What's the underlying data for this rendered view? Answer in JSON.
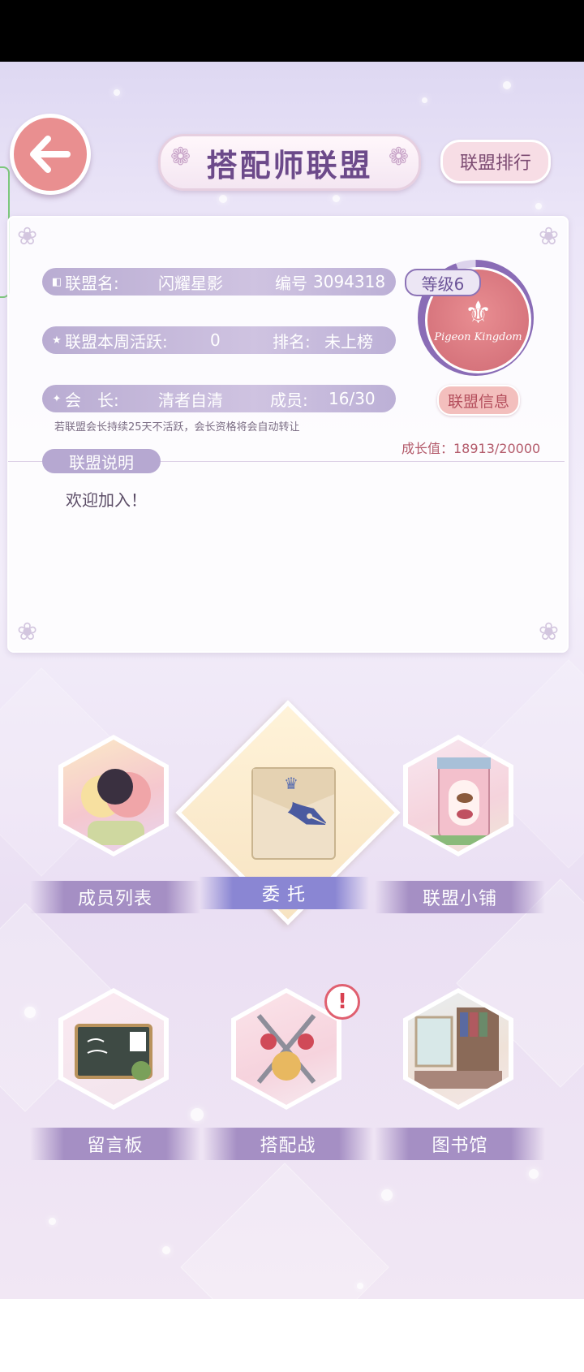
{
  "header": {
    "title": "搭配师联盟",
    "rank_button": "联盟排行"
  },
  "alliance": {
    "name_label": "联盟名:",
    "name_value": "闪耀星影",
    "id_label": "编号",
    "id_value": "3094318",
    "weekly_label": "联盟本周活跃:",
    "weekly_value": "0",
    "rank_label": "排名:",
    "rank_value": "未上榜",
    "leader_label": "会　长:",
    "leader_value": "清者自清",
    "members_label": "成员:",
    "members_value": "16/30",
    "level": "等级6",
    "emblem_text": "Pigeon Kingdom",
    "info_button": "联盟信息",
    "warning": "若联盟会长持续25天不活跃，会长资格将会自动转让",
    "growth": "成长值：18913/20000",
    "growth_fraction": 0.9457
  },
  "description": {
    "tab_label": "联盟说明",
    "text": "欢迎加入！"
  },
  "features": [
    {
      "label": "成员列表",
      "icon": "members-icon"
    },
    {
      "label": "委 托",
      "icon": "commission-icon"
    },
    {
      "label": "联盟小铺",
      "icon": "shop-icon"
    },
    {
      "label": "留言板",
      "icon": "message-board-icon"
    },
    {
      "label": "搭配战",
      "icon": "battle-icon",
      "alert": "!"
    },
    {
      "label": "图书馆",
      "icon": "library-icon"
    }
  ],
  "colors": {
    "accent": "#8a6cb6",
    "back_button": "#e98f90",
    "emblem": "#cf6a74"
  }
}
